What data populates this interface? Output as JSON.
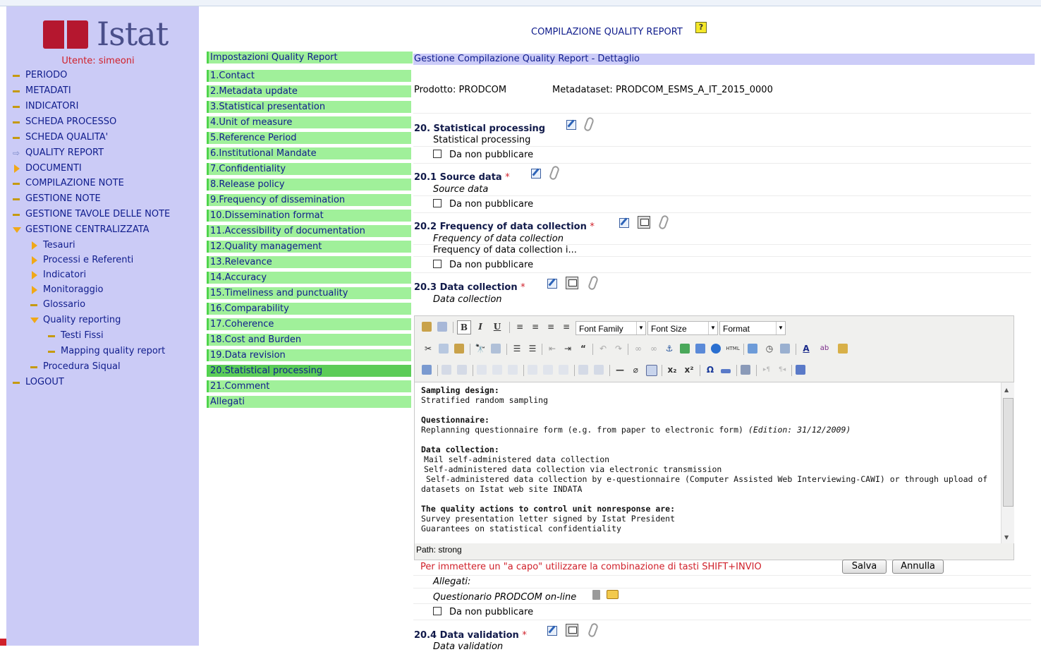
{
  "sidebar": {
    "logo_text": "Istat",
    "user_label": "Utente: simeoni",
    "menu": [
      {
        "label": "PERIODO",
        "icon": "dash-icon"
      },
      {
        "label": "METADATI",
        "icon": "dash-icon"
      },
      {
        "label": "INDICATORI",
        "icon": "dash-icon"
      },
      {
        "label": "SCHEDA PROCESSO",
        "icon": "dash-icon"
      },
      {
        "label": "SCHEDA QUALITA'",
        "icon": "dash-icon"
      },
      {
        "label": "QUALITY REPORT",
        "icon": "arrow-right-icon"
      },
      {
        "label": "DOCUMENTI",
        "icon": "expand-arrow-icon"
      },
      {
        "label": "COMPILAZIONE NOTE",
        "icon": "dash-icon"
      },
      {
        "label": "GESTIONE NOTE",
        "icon": "dash-icon"
      },
      {
        "label": "GESTIONE TAVOLE DELLE NOTE",
        "icon": "dash-icon"
      },
      {
        "label": "GESTIONE CENTRALIZZATA",
        "icon": "collapse-arrow-icon"
      },
      {
        "label": "Tesauri",
        "icon": "expand-arrow-icon"
      },
      {
        "label": "Processi e Referenti",
        "icon": "expand-arrow-icon"
      },
      {
        "label": "Indicatori",
        "icon": "expand-arrow-icon"
      },
      {
        "label": "Monitoraggio",
        "icon": "expand-arrow-icon"
      },
      {
        "label": "Glossario",
        "icon": "dash-icon"
      },
      {
        "label": "Quality reporting",
        "icon": "collapse-arrow-icon"
      },
      {
        "label": "Testi Fissi",
        "icon": "dash-icon"
      },
      {
        "label": "Mapping quality report",
        "icon": "dash-icon"
      },
      {
        "label": "Procedura Siqual",
        "icon": "dash-icon"
      },
      {
        "label": "LOGOUT",
        "icon": "dash-icon"
      }
    ]
  },
  "header": {
    "title": "COMPILAZIONE QUALITY REPORT",
    "help_icon": "?"
  },
  "nav": {
    "head": "Impostazioni Quality Report",
    "items": [
      "1.Contact",
      "2.Metadata update",
      "3.Statistical presentation",
      "4.Unit of measure",
      "5.Reference Period",
      "6.Institutional Mandate",
      "7.Confidentiality",
      "8.Release policy",
      "9.Frequency of dissemination",
      "10.Dissemination format",
      "11.Accessibility of documentation",
      "12.Quality management",
      "13.Relevance",
      "14.Accuracy",
      "15.Timeliness and punctuality",
      "16.Comparability",
      "17.Coherence",
      "18.Cost and Burden",
      "19.Data revision",
      "20.Statistical processing",
      "21.Comment",
      "Allegati"
    ],
    "active_index": 19
  },
  "detail": {
    "bar_title": "Gestione Compilazione Quality Report - Dettaglio",
    "product": "Prodotto: PRODCOM",
    "metadataset": "Metadataset:   PRODCOM_ESMS_A_IT_2015_0000"
  },
  "sections": {
    "s20": {
      "title": "20. Statistical processing",
      "sub": "Statistical processing",
      "unpublish": "Da non pubblicare"
    },
    "s201": {
      "title": "20.1 Source data",
      "sub": "Source data",
      "unpublish": "Da non pubblicare"
    },
    "s202": {
      "title": "20.2 Frequency of data collection",
      "sub1": "Frequency of data collection",
      "sub2": "Frequency of data collection i...",
      "unpublish": "Da non pubblicare"
    },
    "s203": {
      "title": "20.3 Data collection",
      "sub": "Data collection"
    },
    "s204": {
      "title": "20.4 Data validation",
      "sub": "Data validation"
    },
    "required_mark": "*"
  },
  "editor": {
    "font_family": "Font Family",
    "font_size": "Font Size",
    "format": "Format",
    "path": "Path: strong",
    "content": {
      "h1": "Sampling design:",
      "t1": "Stratified random sampling",
      "h2": "Questionnaire:",
      "t2": "Replanning questionnaire form (e.g. from paper to electronic form)",
      "t2_edition": "(Edition: 31/12/2009)",
      "h3": "Data collection:",
      "t3a": "Mail self-administered data collection",
      "t3b": "Self-administered data collection via electronic transmission",
      "t3c": "Self-administered data collection by e-questionnaire (Computer Assisted Web Interviewing-CAWI) or through upload of",
      "t3d": "datasets on Istat web site INDATA",
      "h4": "The quality actions to control unit nonresponse are:",
      "t4a": "Survey presentation letter signed by Istat President",
      "t4b": "Guarantees on statistical confidentiality"
    }
  },
  "footer": {
    "hint": "Per immettere un \"a capo\" utilizzare la combinazione di tasti SHIFT+INVIO",
    "save": "Salva",
    "cancel": "Annulla",
    "attachments_label": "Allegati:",
    "attachment_name": "Questionario PRODCOM on-line",
    "unpublish": "Da non pubblicare"
  },
  "colors": {
    "sidebar_bg": "#cbcbf6",
    "nav_bg": "#a0f09a",
    "nav_active": "#5ccc58",
    "link": "#0f1c8c",
    "required": "#d0202a"
  }
}
